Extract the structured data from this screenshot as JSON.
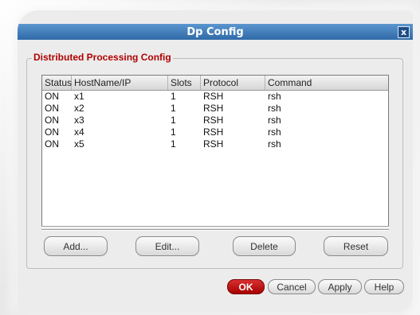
{
  "window": {
    "title": "Dp Config",
    "close_label": "x"
  },
  "group": {
    "legend": "Distributed Processing Config"
  },
  "table": {
    "columns": [
      "Status",
      "HostName/IP",
      "Slots",
      "Protocol",
      "Command"
    ],
    "rows": [
      [
        "ON",
        "x1",
        "1",
        "RSH",
        "rsh"
      ],
      [
        "ON",
        "x2",
        "1",
        "RSH",
        "rsh"
      ],
      [
        "ON",
        "x3",
        "1",
        "RSH",
        "rsh"
      ],
      [
        "ON",
        "x4",
        "1",
        "RSH",
        "rsh"
      ],
      [
        "ON",
        "x5",
        "1",
        "RSH",
        "rsh"
      ]
    ]
  },
  "actions": {
    "add": "Add...",
    "edit": "Edit...",
    "delete": "Delete",
    "reset": "Reset"
  },
  "footer": {
    "ok": "OK",
    "cancel": "Cancel",
    "apply": "Apply",
    "help": "Help"
  },
  "colors": {
    "title_bar": "#2f6aa8",
    "legend_text": "#b00000",
    "ok_button": "#c00000"
  }
}
